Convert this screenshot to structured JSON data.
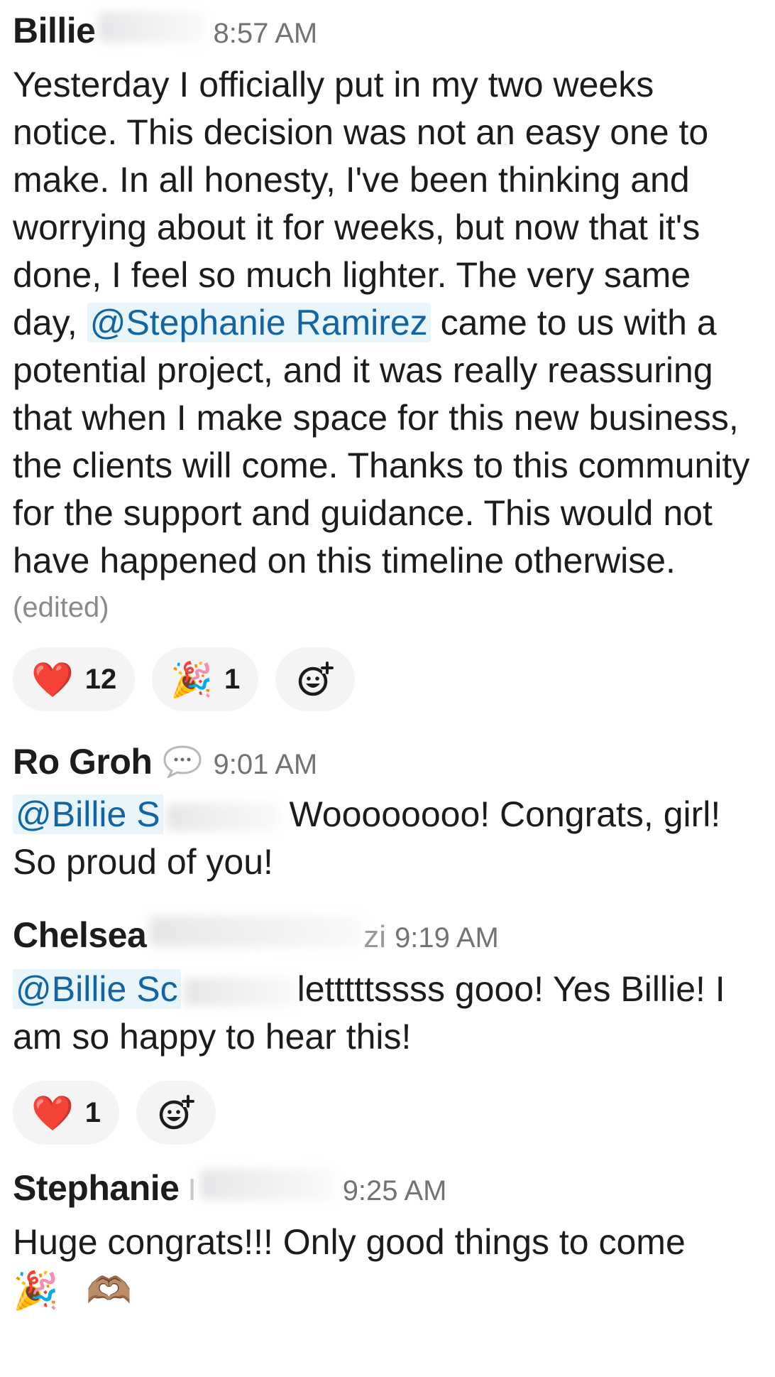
{
  "messages": [
    {
      "author": "Billie",
      "author_tail": "",
      "time": "8:57 AM",
      "text_before": "Yesterday I officially put in my two weeks notice. This decision was not an easy one to make. In all honesty, I've been thinking and worrying about it for weeks, but now that it's done, I feel so much lighter. The very same day, ",
      "mention": "@Stephanie Ramirez",
      "text_after": " came to us with a potential project, and it was really reassuring that when I make space for this new business, the clients will come. Thanks to this community for the support and guidance. This would not have happened on this timeline otherwise.",
      "edited": "(edited)",
      "reactions": [
        {
          "emoji": "❤️",
          "count": "12"
        },
        {
          "emoji": "🎉",
          "count": "1"
        }
      ]
    },
    {
      "author": "Ro Groh",
      "time": "9:01 AM",
      "mention": "@Billie S",
      "text_after": "Woooooooo! Congrats, girl! So proud of you!"
    },
    {
      "author": "Chelsea",
      "author_tail": "zi",
      "time": "9:19 AM",
      "mention": "@Billie Sc",
      "text_after": "letttttssss gooo! Yes Billie! I am so happy to hear this!",
      "reactions": [
        {
          "emoji": "❤️",
          "count": "1"
        }
      ]
    },
    {
      "author": "Stephanie",
      "author_tail": "I",
      "time": "9:25 AM",
      "text": "Huge congrats!!! Only good things to come",
      "emoji_line": "🎉 🫶🏽"
    }
  ],
  "icons": {
    "add_reaction": "add-reaction-icon",
    "status": "speech-bubble-icon"
  },
  "colors": {
    "mention_text": "#1264a3",
    "mention_bg": "#e8f5fa",
    "pill_bg": "#f4f4f5",
    "timestamp": "#737373"
  }
}
